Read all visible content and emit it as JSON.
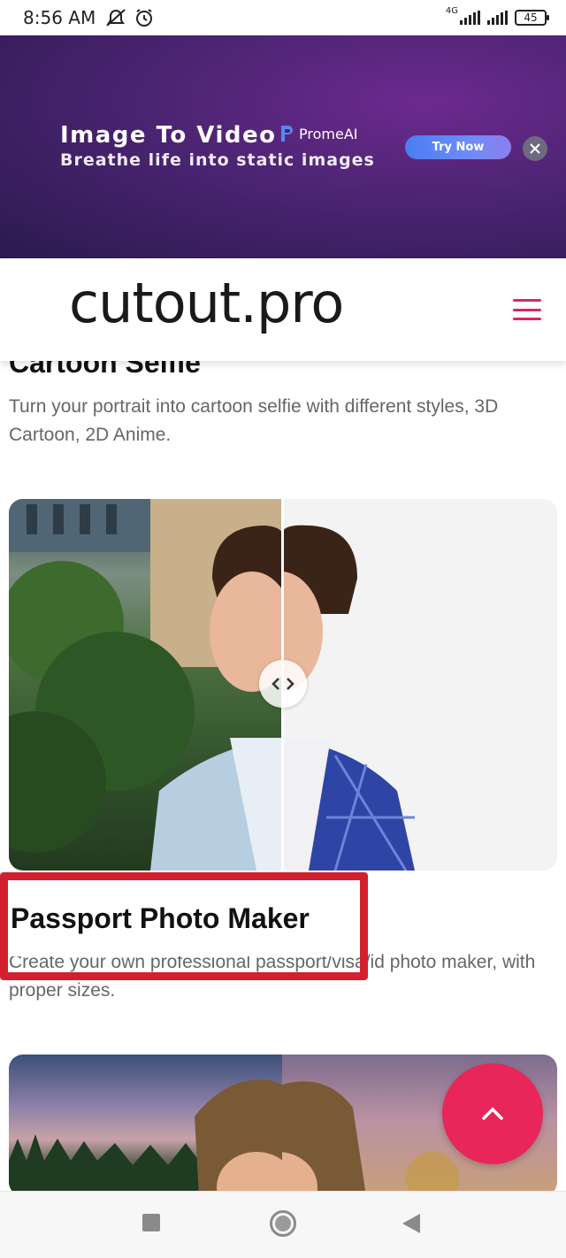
{
  "status_bar": {
    "time": "8:56 AM",
    "network": "4G",
    "battery": "45"
  },
  "ad": {
    "title": "Image To Video",
    "subtitle": "Breathe life into static images",
    "brand": "PromeAI",
    "cta": "Try Now",
    "close_icon": "close-icon",
    "colors": {
      "background": "#4b2472",
      "cta": "#5b86f2"
    }
  },
  "header": {
    "logo": "cutout.pro",
    "menu_icon": "hamburger-menu-icon",
    "accent": "#e0245e"
  },
  "content": {
    "prev_section_title": "Cartoon Selfie",
    "prev_section_desc": "Turn your portrait into cartoon selfie with different styles, 3D Cartoon, 2D Anime.",
    "passport": {
      "title": "Passport Photo Maker",
      "desc": "Create your own professional passport/visa/id photo maker, with proper sizes.",
      "slider_icon": "compare-slider-icon"
    }
  },
  "scroll_top": {
    "icon": "chevron-up-icon",
    "color": "#e8265a"
  },
  "highlight_color": "#d2202f",
  "nav": {
    "recents": "square-icon",
    "home": "circle-icon",
    "back": "triangle-back-icon"
  }
}
